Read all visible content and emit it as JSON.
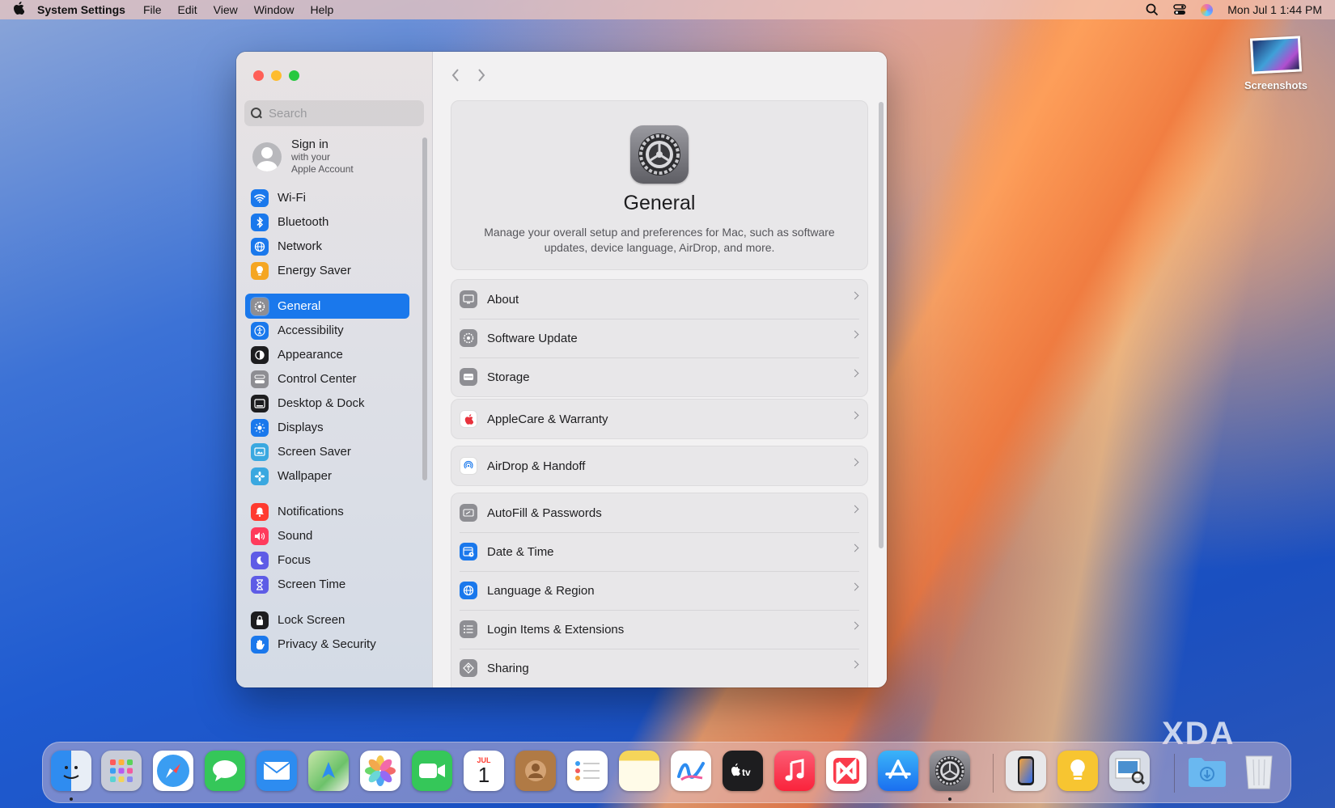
{
  "menubar": {
    "app_name": "System Settings",
    "menus": [
      "File",
      "Edit",
      "View",
      "Window",
      "Help"
    ],
    "datetime": "Mon Jul 1  1:44 PM"
  },
  "desktop": {
    "icon_label": "Screenshots"
  },
  "sidebar": {
    "search_placeholder": "Search",
    "account": {
      "title": "Sign in",
      "subtitle_1": "with your",
      "subtitle_2": "Apple Account"
    },
    "items": [
      {
        "label": "Wi-Fi",
        "icon": "wifi-icon",
        "color": "#1a78ec"
      },
      {
        "label": "Bluetooth",
        "icon": "bluetooth-icon",
        "color": "#1a78ec"
      },
      {
        "label": "Network",
        "icon": "globe-icon",
        "color": "#1a78ec"
      },
      {
        "label": "Energy Saver",
        "icon": "lightbulb-icon",
        "color": "#f5a623"
      },
      {
        "label": "General",
        "icon": "gear-icon",
        "color": "#8e8e93",
        "selected": true
      },
      {
        "label": "Accessibility",
        "icon": "accessibility-icon",
        "color": "#1a78ec"
      },
      {
        "label": "Appearance",
        "icon": "appearance-icon",
        "color": "#1d1d1f"
      },
      {
        "label": "Control Center",
        "icon": "control-center-icon",
        "color": "#8e8e93"
      },
      {
        "label": "Desktop & Dock",
        "icon": "dock-icon",
        "color": "#1d1d1f"
      },
      {
        "label": "Displays",
        "icon": "sun-icon",
        "color": "#1a78ec"
      },
      {
        "label": "Screen Saver",
        "icon": "screen-saver-icon",
        "color": "#3aa8e0"
      },
      {
        "label": "Wallpaper",
        "icon": "flower-icon",
        "color": "#3aa8e0"
      },
      {
        "label": "Notifications",
        "icon": "bell-icon",
        "color": "#ff3b30"
      },
      {
        "label": "Sound",
        "icon": "speaker-icon",
        "color": "#ff3b5c"
      },
      {
        "label": "Focus",
        "icon": "moon-icon",
        "color": "#5e5ce6"
      },
      {
        "label": "Screen Time",
        "icon": "hourglass-icon",
        "color": "#5e5ce6"
      },
      {
        "label": "Lock Screen",
        "icon": "lock-icon",
        "color": "#1d1d1f"
      },
      {
        "label": "Privacy & Security",
        "icon": "hand-icon",
        "color": "#1a78ec"
      }
    ]
  },
  "main": {
    "title": "General",
    "description": "Manage your overall setup and preferences for Mac, such as software updates, device language, AirDrop, and more.",
    "groups": [
      [
        {
          "label": "About",
          "icon": "display-icon",
          "color": "#8e8e93"
        },
        {
          "label": "Software Update",
          "icon": "gear-refresh-icon",
          "color": "#8e8e93"
        },
        {
          "label": "Storage",
          "icon": "drive-icon",
          "color": "#8e8e93"
        }
      ],
      [
        {
          "label": "AppleCare & Warranty",
          "icon": "apple-icon",
          "color": "#ffffff"
        }
      ],
      [
        {
          "label": "AirDrop & Handoff",
          "icon": "airdrop-icon",
          "color": "#ffffff"
        }
      ],
      [
        {
          "label": "AutoFill & Passwords",
          "icon": "autofill-icon",
          "color": "#8e8e93"
        },
        {
          "label": "Date & Time",
          "icon": "calendar-clock-icon",
          "color": "#1a78ec"
        },
        {
          "label": "Language & Region",
          "icon": "globe-icon",
          "color": "#1a78ec"
        },
        {
          "label": "Login Items & Extensions",
          "icon": "list-icon",
          "color": "#8e8e93"
        },
        {
          "label": "Sharing",
          "icon": "sharing-icon",
          "color": "#8e8e93"
        }
      ]
    ]
  },
  "dock": {
    "calendar_month": "JUL",
    "calendar_day": "1",
    "apps": [
      {
        "name": "finder-icon",
        "color": "#2f8cf0"
      },
      {
        "name": "launchpad-icon",
        "color": "#c8ccd8"
      },
      {
        "name": "safari-icon",
        "color": "#3a9df2"
      },
      {
        "name": "messages-icon",
        "color": "#35c759"
      },
      {
        "name": "mail-icon",
        "color": "#2d8cf0"
      },
      {
        "name": "maps-icon",
        "color": "#6cc26a"
      },
      {
        "name": "photos-icon",
        "color": "#ffffff"
      },
      {
        "name": "facetime-icon",
        "color": "#35c759"
      },
      {
        "name": "calendar-icon",
        "color": "#ffffff"
      },
      {
        "name": "contacts-icon",
        "color": "#b07a45"
      },
      {
        "name": "reminders-icon",
        "color": "#ffffff"
      },
      {
        "name": "notes-icon",
        "color": "#f5d55a"
      },
      {
        "name": "freeform-icon",
        "color": "#ffffff"
      },
      {
        "name": "tv-icon",
        "color": "#1d1d1f"
      },
      {
        "name": "music-icon",
        "color": "#fa3b4b"
      },
      {
        "name": "news-icon",
        "color": "#ffffff"
      },
      {
        "name": "app-store-icon",
        "color": "#2f8cf0"
      },
      {
        "name": "system-settings-icon",
        "color": "#7e7e84"
      },
      {
        "name": "iphone-mirroring-icon",
        "color": "#e8e8ea"
      },
      {
        "name": "tips-icon",
        "color": "#f7c531"
      },
      {
        "name": "preview-icon",
        "color": "#d8dde6"
      },
      {
        "name": "downloads-folder-icon",
        "color": "#6ab8f0"
      },
      {
        "name": "trash-icon",
        "color": "#e0e3e8"
      }
    ]
  },
  "watermark": "XDA"
}
